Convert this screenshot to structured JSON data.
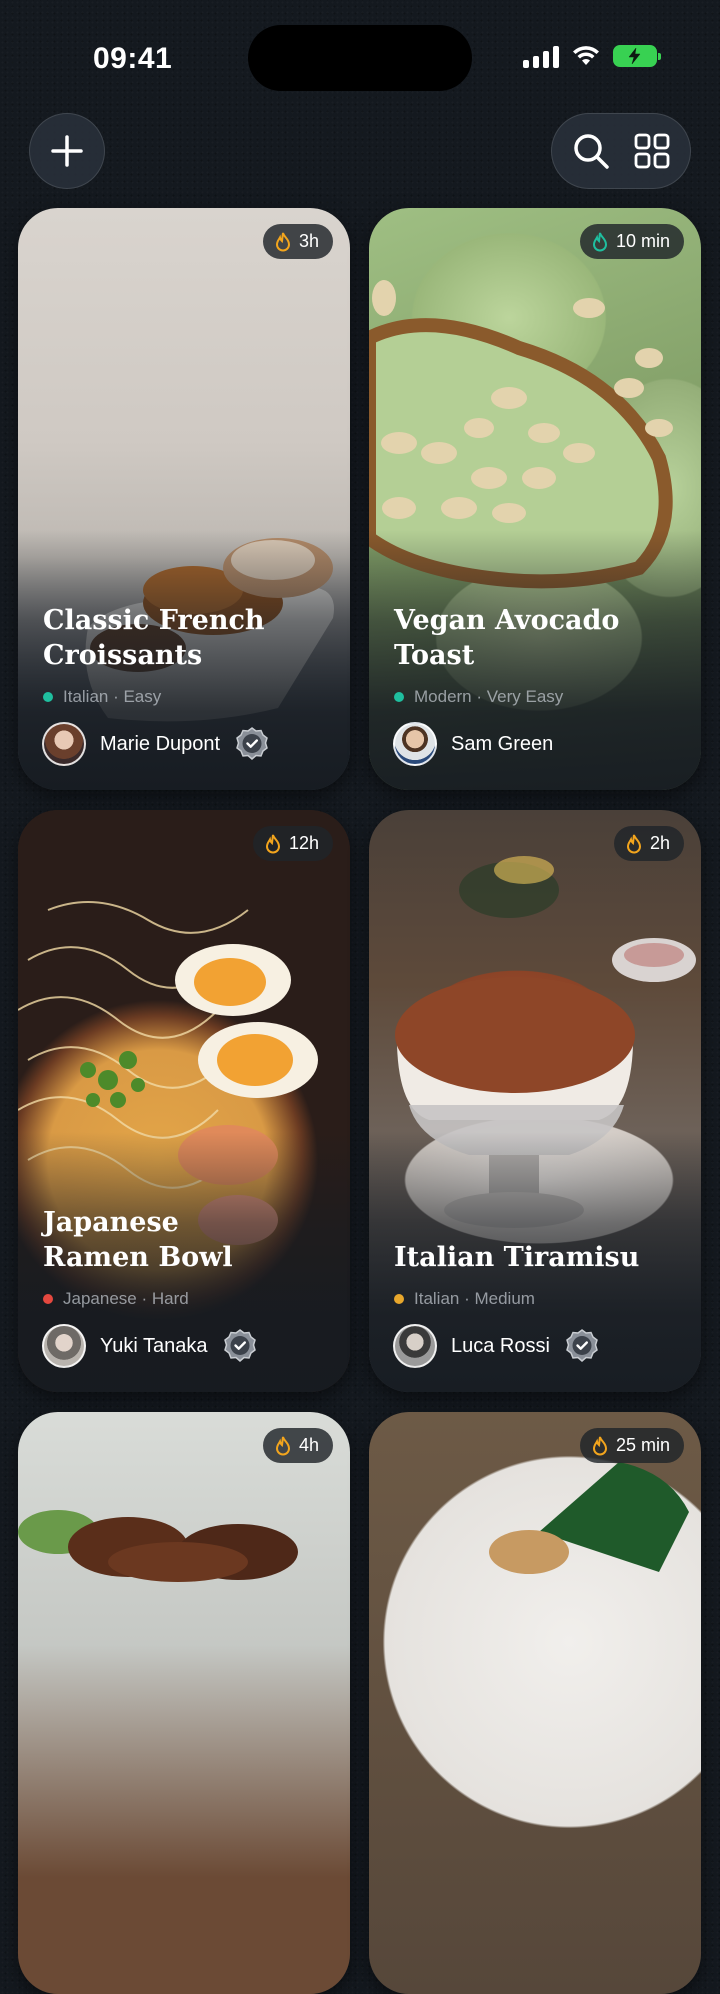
{
  "status_bar": {
    "time": "09:41"
  },
  "toolbar": {
    "add_icon": "plus-icon",
    "search_icon": "search-icon",
    "grid_icon": "grid-icon"
  },
  "colors": {
    "background": "#14191f",
    "italian_dot": "#1fbf9f",
    "modern_dot": "#1fbf9f",
    "japanese_dot": "#e5483f",
    "italian_medium_dot": "#e8a72c",
    "flame": "#f3a51d",
    "flame_teal": "#1fbf9f"
  },
  "recipes": [
    {
      "time": "3h",
      "title": "Classic French Croissants",
      "category": "Italian",
      "difficulty": "Easy",
      "meta": "Italian · Easy",
      "author": "Marie Dupont",
      "verified": true
    },
    {
      "time": "10 min",
      "title": "Vegan Avocado Toast",
      "category": "Modern",
      "difficulty": "Very Easy",
      "meta": "Modern · Very Easy",
      "author": "Sam Green",
      "verified": false
    },
    {
      "time": "12h",
      "title": "Japanese Ramen Bowl",
      "category": "Japanese",
      "difficulty": "Hard",
      "meta": "Japanese · Hard",
      "author": "Yuki Tanaka",
      "verified": true
    },
    {
      "time": "2h",
      "title": "Italian Tiramisu",
      "category": "Italian",
      "difficulty": "Medium",
      "meta": "Italian · Medium",
      "author": "Luca Rossi",
      "verified": true
    },
    {
      "time": "4h"
    },
    {
      "time": "25 min"
    }
  ]
}
